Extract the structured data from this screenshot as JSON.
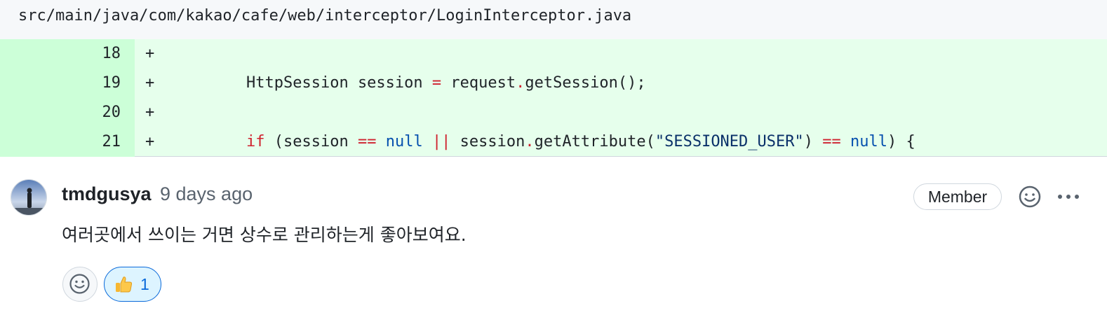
{
  "file": {
    "path": "src/main/java/com/kakao/cafe/web/interceptor/LoginInterceptor.java"
  },
  "diff": {
    "rows": [
      {
        "num": "18",
        "sign": "+"
      },
      {
        "num": "19",
        "sign": "+"
      },
      {
        "num": "20",
        "sign": "+"
      },
      {
        "num": "21",
        "sign": "+"
      }
    ],
    "line19": {
      "a": "HttpSession session ",
      "op1": "=",
      "b": " request",
      "dot": ".",
      "c": "getSession();"
    },
    "line21": {
      "kw_if": "if",
      "a": " (session ",
      "op1": "==",
      "sp1": " ",
      "null1": "null",
      "sp2": " ",
      "op2": "||",
      "b": " session",
      "dot": ".",
      "c": "getAttribute(",
      "str": "\"SESSIONED_USER\"",
      "d": ") ",
      "op3": "==",
      "sp3": " ",
      "null2": "null",
      "e": ") {"
    }
  },
  "comment": {
    "author": "tmdgusya",
    "time": "9 days ago",
    "badge": "Member",
    "body": "여러곳에서 쓰이는 거면 상수로 관리하는게 좋아보여요.",
    "reactions": [
      {
        "emoji": "thumbs-up",
        "count": "1"
      }
    ]
  },
  "colors": {
    "added_line_bg": "#e6ffec",
    "added_gutter_bg": "#ccffd8",
    "reaction_active": "#0969da"
  }
}
